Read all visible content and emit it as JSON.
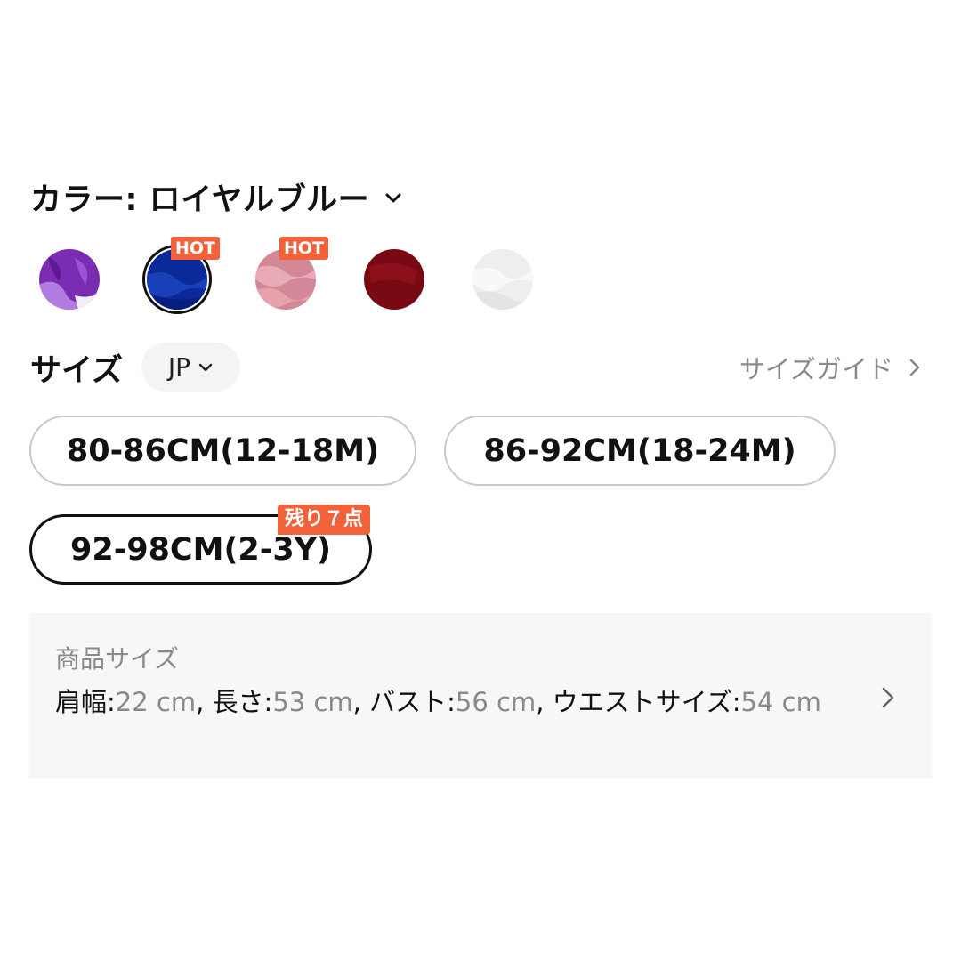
{
  "color": {
    "label": "カラー: ロイヤルブルー",
    "swatches": [
      {
        "name": "purple",
        "hex": "#7d2fb8"
      },
      {
        "name": "royal-blue",
        "hex": "#0a2a9a",
        "selected": true,
        "badge": "HOT"
      },
      {
        "name": "pink",
        "hex": "#d58a98",
        "badge": "HOT"
      },
      {
        "name": "wine-red",
        "hex": "#7a0a14"
      },
      {
        "name": "white",
        "hex": "#f2f2f2"
      }
    ]
  },
  "size": {
    "title": "サイズ",
    "region": "JP",
    "guide_label": "サイズガイド",
    "options": [
      {
        "label": "80-86CM(12-18M)"
      },
      {
        "label": "86-92CM(18-24M)"
      },
      {
        "label": "92-98CM(2-3Y)",
        "selected": true,
        "stock_badge": "残り７点"
      }
    ]
  },
  "product_size": {
    "title": "商品サイズ",
    "items": [
      {
        "label": "肩幅:",
        "value": "22 cm"
      },
      {
        "label": "長さ:",
        "value": "53 cm"
      },
      {
        "label": "バスト:",
        "value": "56 cm"
      },
      {
        "label": "ウエストサイズ:",
        "value": "54 cm"
      }
    ]
  },
  "accent_color": "#f2623a"
}
